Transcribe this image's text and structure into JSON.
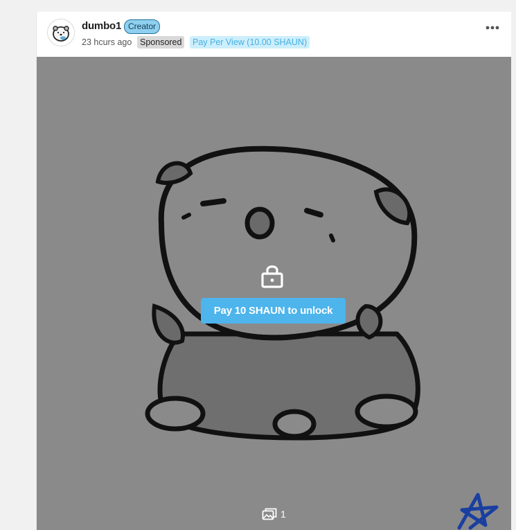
{
  "post": {
    "author": {
      "username": "dumbo1",
      "badge": "Creator",
      "avatar_icon": "bear-avatar-icon"
    },
    "timestamp": "23 hcurs ago",
    "sponsored_label": "Sponsored",
    "pay_per_view_label": "Pay Per View (10.00 SHAUN)",
    "more_icon": "more-horizontal-icon",
    "media": {
      "lock_icon": "lock-icon",
      "unlock_button_label": "Pay 10 SHAUN to unlock",
      "image_count": "1",
      "gallery_icon": "gallery-icon",
      "logo_icon": "shaun-star-logo"
    }
  },
  "colors": {
    "accent": "#4db4ec",
    "creator_badge_bg": "#8fd0f0",
    "sponsored_bg": "#d9d9d9",
    "ppv_text": "#45b0e0",
    "locked_overlay": "#8a8a8a"
  }
}
